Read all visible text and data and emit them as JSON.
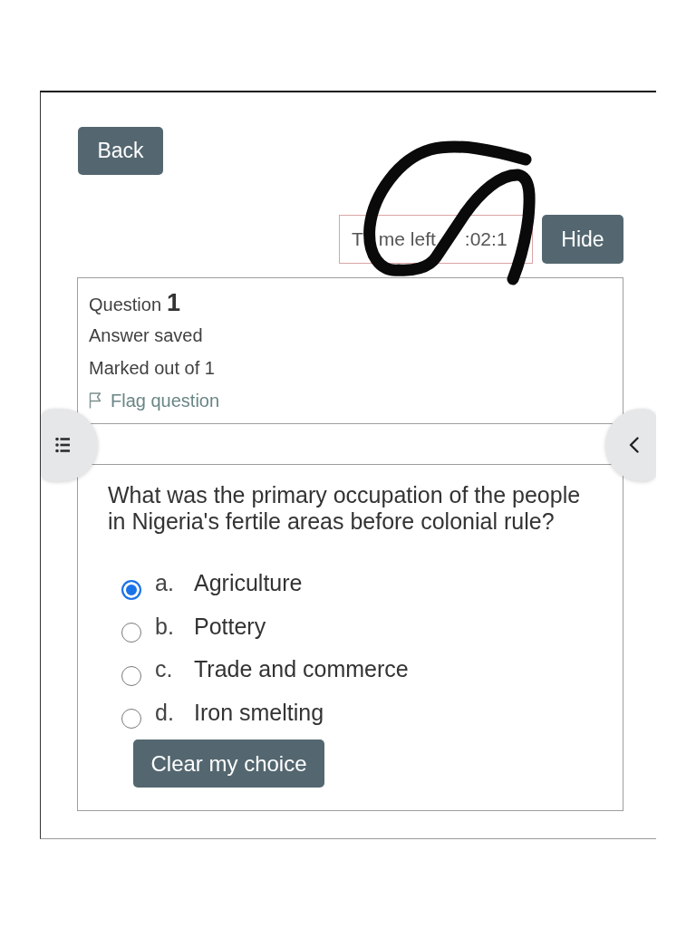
{
  "back_button": {
    "label": "Back"
  },
  "timer": {
    "visible_text": [
      "T",
      "me left",
      ":02:1"
    ]
  },
  "hide_button": {
    "label": "Hide"
  },
  "question_info": {
    "title": "Question",
    "number": "1",
    "status": "Answer saved",
    "marks": "Marked out of 1",
    "flag": {
      "label": "Flag question",
      "flagged": false
    }
  },
  "question": {
    "text": "What was the primary occupation of the people in Nigeria's fertile areas before colonial rule?",
    "options": [
      {
        "letter": "a.",
        "text": "Agriculture",
        "selected": true
      },
      {
        "letter": "b.",
        "text": "Pottery",
        "selected": false
      },
      {
        "letter": "c.",
        "text": "Trade and commerce",
        "selected": false
      },
      {
        "letter": "d.",
        "text": "Iron smelting",
        "selected": false
      }
    ],
    "clear_button": {
      "label": "Clear my choice"
    }
  }
}
